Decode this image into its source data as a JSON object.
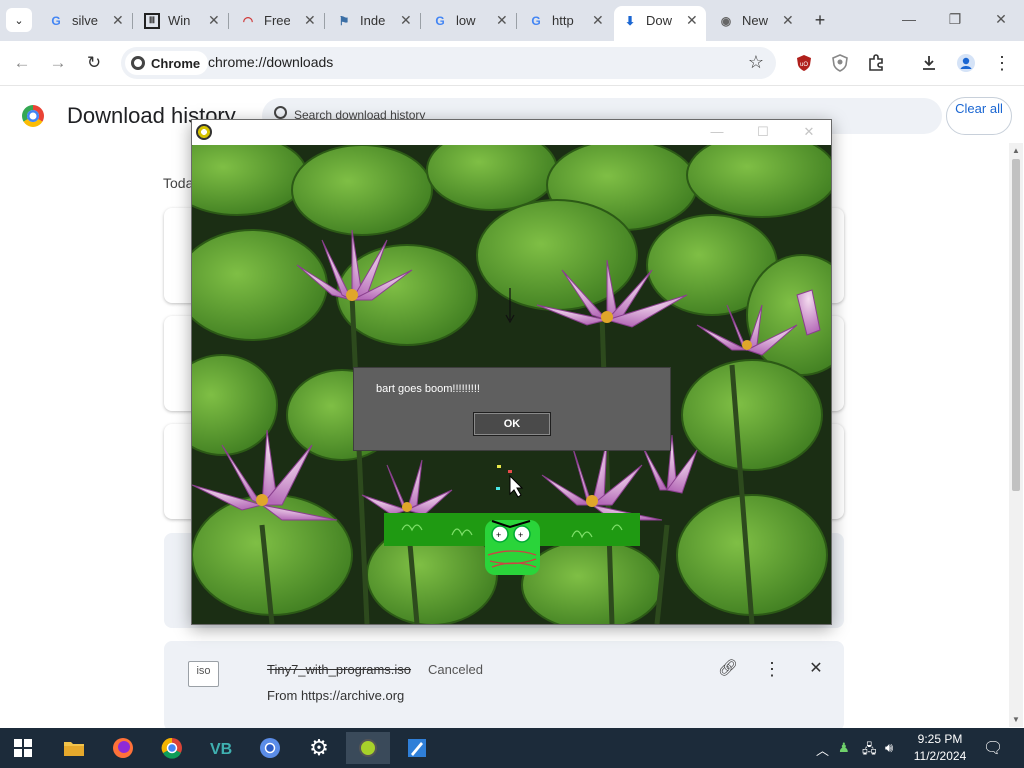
{
  "tabs": [
    {
      "title": "silve",
      "favicon": "google-icon"
    },
    {
      "title": "Win",
      "favicon": "archive-icon"
    },
    {
      "title": "Free",
      "favicon": "rainbow-icon"
    },
    {
      "title": "Inde",
      "favicon": "windows-flag-icon"
    },
    {
      "title": "low",
      "favicon": "google-icon"
    },
    {
      "title": "http",
      "favicon": "google-icon"
    },
    {
      "title": "Dow",
      "favicon": "download-icon",
      "active": true
    },
    {
      "title": "New",
      "favicon": "chrome-icon"
    }
  ],
  "toolbar": {
    "chip_label": "Chrome",
    "url": "chrome://downloads"
  },
  "downloads": {
    "title": "Download history",
    "search_placeholder": "Search download history",
    "clear_all": "Clear all",
    "section_label": "Today",
    "visible_item": {
      "icon_label": "iso",
      "filename": "Tiny7_with_programs.iso",
      "status": "Canceled",
      "source": "From https://archive.org"
    }
  },
  "app_window": {
    "message": "bart goes boom!!!!!!!!!",
    "ok_label": "OK"
  },
  "taskbar": {
    "time": "9:25 PM",
    "date": "11/2/2024"
  },
  "colors": {
    "tab_strip": "#dfe3eb",
    "taskbar": "#1c2b3a",
    "link_blue": "#1a66d2",
    "dialog_grey": "#5f5f5f",
    "frog_green": "#2ad43a"
  }
}
